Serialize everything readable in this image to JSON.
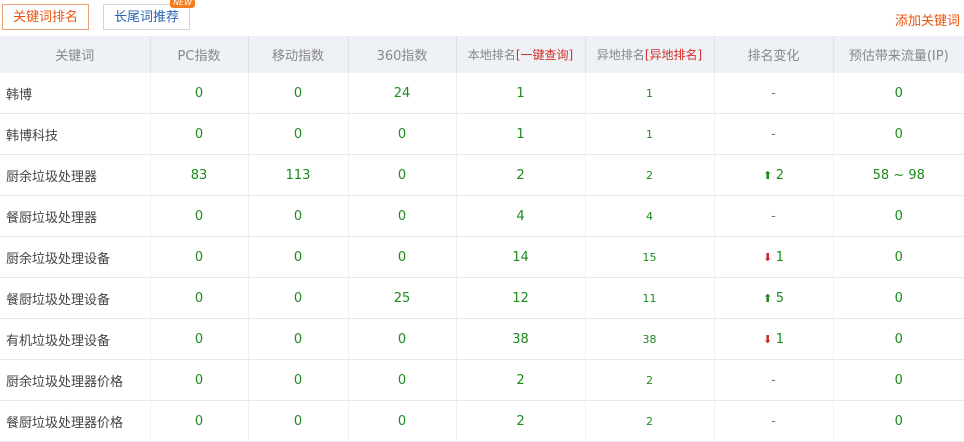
{
  "tabs": {
    "active": "关键词排名",
    "second": "长尾词推荐",
    "new_badge": "NEW"
  },
  "add_keyword": "添加关键词",
  "columns": {
    "keyword": "关键词",
    "pc": "PC指数",
    "mobile": "移动指数",
    "s360": "360指数",
    "local": "本地排名",
    "local_link": "[一键查询]",
    "remote": "异地排名",
    "remote_link": "[异地排名]",
    "change": "排名变化",
    "traffic": "预估带来流量(IP)"
  },
  "rows": [
    {
      "keyword": "韩博",
      "pc": "0",
      "mobile": "0",
      "s360": "24",
      "local": "1",
      "remote": "1",
      "change": "-",
      "trend": "none",
      "traffic": "0"
    },
    {
      "keyword": "韩博科技",
      "pc": "0",
      "mobile": "0",
      "s360": "0",
      "local": "1",
      "remote": "1",
      "change": "-",
      "trend": "none",
      "traffic": "0"
    },
    {
      "keyword": "厨余垃圾处理器",
      "pc": "83",
      "mobile": "113",
      "s360": "0",
      "local": "2",
      "remote": "2",
      "change": "2",
      "trend": "up",
      "traffic": "58 ~ 98"
    },
    {
      "keyword": "餐厨垃圾处理器",
      "pc": "0",
      "mobile": "0",
      "s360": "0",
      "local": "4",
      "remote": "4",
      "change": "-",
      "trend": "none",
      "traffic": "0"
    },
    {
      "keyword": "厨余垃圾处理设备",
      "pc": "0",
      "mobile": "0",
      "s360": "0",
      "local": "14",
      "remote": "15",
      "change": "1",
      "trend": "down",
      "traffic": "0"
    },
    {
      "keyword": "餐厨垃圾处理设备",
      "pc": "0",
      "mobile": "0",
      "s360": "25",
      "local": "12",
      "remote": "11",
      "change": "5",
      "trend": "up",
      "traffic": "0"
    },
    {
      "keyword": "有机垃圾处理设备",
      "pc": "0",
      "mobile": "0",
      "s360": "0",
      "local": "38",
      "remote": "38",
      "change": "1",
      "trend": "down",
      "traffic": "0"
    },
    {
      "keyword": "厨余垃圾处理器价格",
      "pc": "0",
      "mobile": "0",
      "s360": "0",
      "local": "2",
      "remote": "2",
      "change": "-",
      "trend": "none",
      "traffic": "0"
    },
    {
      "keyword": "餐厨垃圾处理器价格",
      "pc": "0",
      "mobile": "0",
      "s360": "0",
      "local": "2",
      "remote": "2",
      "change": "-",
      "trend": "none",
      "traffic": "0"
    }
  ]
}
